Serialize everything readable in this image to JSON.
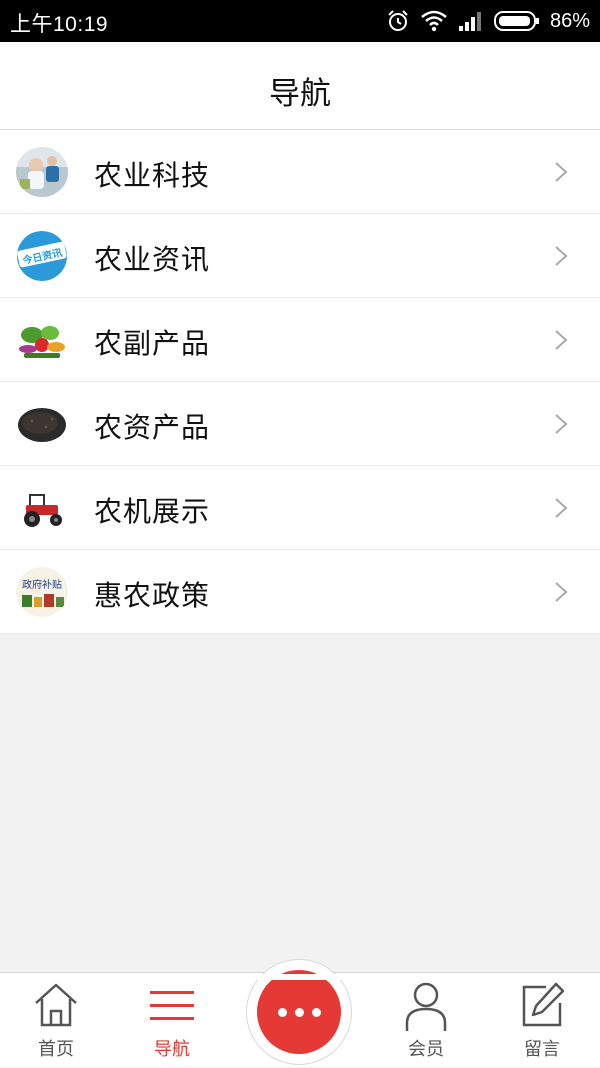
{
  "status_bar": {
    "time": "上午10:19",
    "battery": "86%",
    "icons": [
      "alarm-icon",
      "wifi-icon",
      "signal-icon",
      "battery-icon"
    ]
  },
  "header": {
    "title": "导航"
  },
  "menu": {
    "items": [
      {
        "label": "农业科技",
        "thumb": "agri-tech-thumb"
      },
      {
        "label": "农业资讯",
        "thumb": "agri-news-thumb",
        "thumb_text": "今日资讯"
      },
      {
        "label": "农副产品",
        "thumb": "farm-products-thumb"
      },
      {
        "label": "农资产品",
        "thumb": "agri-supplies-thumb"
      },
      {
        "label": "农机展示",
        "thumb": "tractor-thumb"
      },
      {
        "label": "惠农政策",
        "thumb": "policy-thumb",
        "thumb_text": "政府补贴"
      }
    ]
  },
  "bottom_nav": {
    "items": [
      {
        "label": "首页",
        "icon": "home-icon",
        "active": false
      },
      {
        "label": "导航",
        "icon": "menu-icon",
        "active": true
      },
      {
        "label": "",
        "icon": "more-icon",
        "active": false
      },
      {
        "label": "会员",
        "icon": "user-icon",
        "active": false
      },
      {
        "label": "留言",
        "icon": "edit-icon",
        "active": false
      }
    ]
  },
  "colors": {
    "accent": "#e53935",
    "background": "#f2f2f2",
    "surface": "#ffffff",
    "news_blue": "#2a9ad8"
  }
}
